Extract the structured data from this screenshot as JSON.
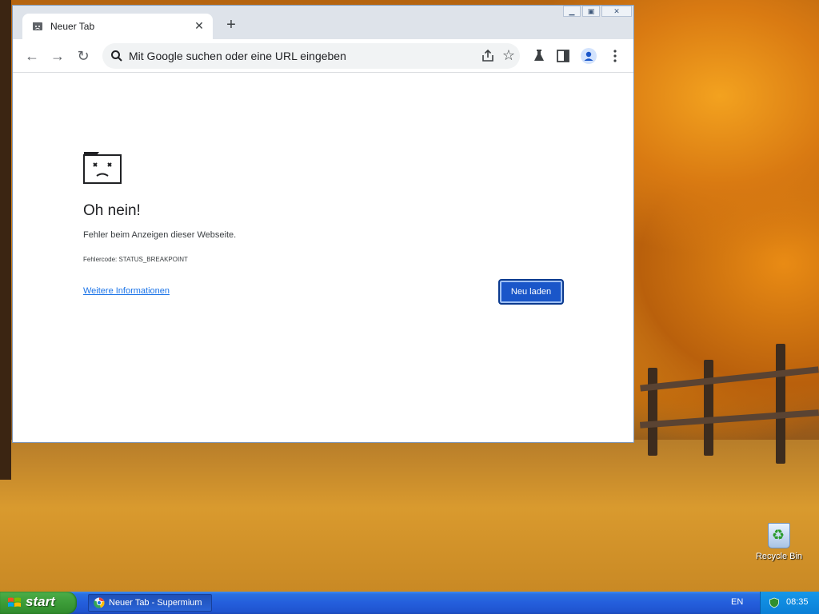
{
  "browser": {
    "tab": {
      "title": "Neuer Tab"
    },
    "omnibox": {
      "placeholder": "Mit Google suchen oder eine URL eingeben"
    }
  },
  "error_page": {
    "heading": "Oh nein!",
    "message": "Fehler beim Anzeigen dieser Webseite.",
    "error_code": "Fehlercode: STATUS_BREAKPOINT",
    "more_info_link": "Weitere Informationen",
    "reload_button": "Neu laden"
  },
  "desktop": {
    "icons": [
      {
        "label": "Recycle Bin",
        "icon": "recycle-bin-icon"
      }
    ]
  },
  "taskbar": {
    "start_label": "start",
    "items": [
      {
        "label": "Neuer Tab - Supermium",
        "icon": "browser-icon"
      }
    ],
    "language": "EN",
    "clock": "08:35"
  },
  "colors": {
    "accent_button": "#1a56c9",
    "link": "#1a73e8",
    "taskbar": "#245edc",
    "start_button": "#3c9c38"
  }
}
